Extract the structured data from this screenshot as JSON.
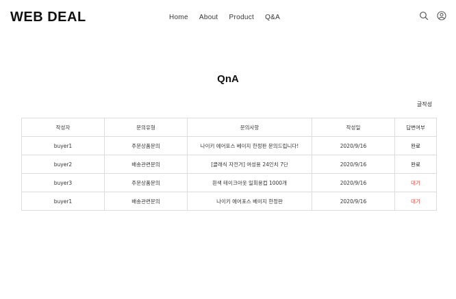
{
  "header": {
    "logo": "WEB DEAL",
    "nav": [
      "Home",
      "About",
      "Product",
      "Q&A"
    ]
  },
  "main": {
    "title": "QnA",
    "write_button": "글작성",
    "columns": [
      "작성자",
      "문의유형",
      "문의사항",
      "작성일",
      "답변여부"
    ],
    "rows": [
      {
        "author": "buyer1",
        "type": "주문상품문의",
        "subject": "나이키 에어포스 베이지 한정판 문의드립니다!",
        "date": "2020/9/16",
        "status": "완료",
        "status_color": "#222222"
      },
      {
        "author": "buyer2",
        "type": "배송관련문의",
        "subject": "[클래식 자전거] 여성용 24인치 7단",
        "date": "2020/9/16",
        "status": "완료",
        "status_color": "#222222"
      },
      {
        "author": "buyer3",
        "type": "주문상품문의",
        "subject": "흰색 테이크아웃 일회용컵 1000개",
        "date": "2020/9/16",
        "status": "대기",
        "status_color": "#e8453c"
      },
      {
        "author": "buyer1",
        "type": "배송관련문의",
        "subject": "나이키 에어포스 베이지 한정판",
        "date": "2020/9/16",
        "status": "대기",
        "status_color": "#e8453c"
      }
    ]
  },
  "icons": [
    "search-icon",
    "user-icon"
  ]
}
